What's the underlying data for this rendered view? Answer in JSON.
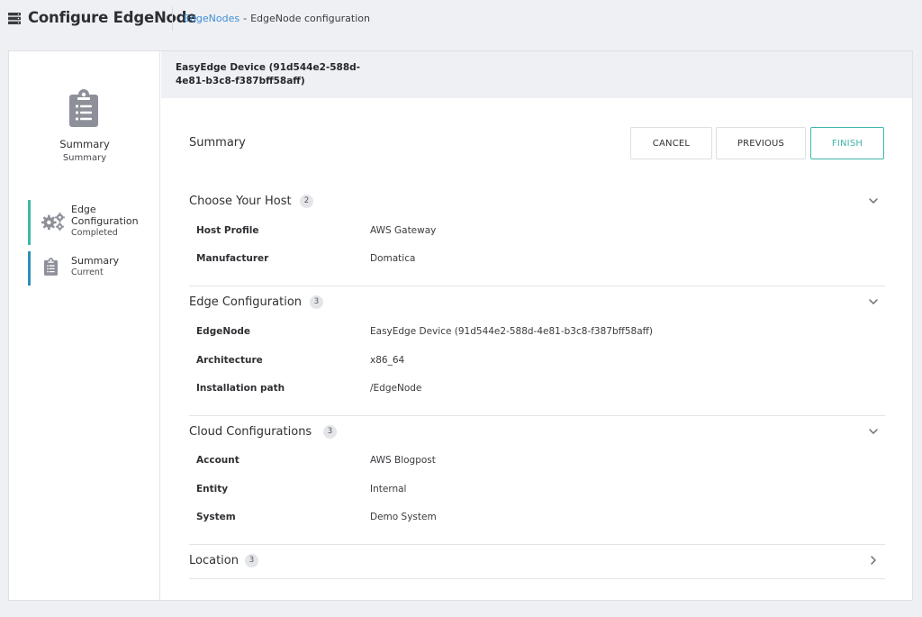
{
  "header": {
    "title": "Configure EdgeNode",
    "breadcrumb": {
      "link": "EdgeNodes",
      "separator": "-",
      "current": "EdgeNode configuration"
    },
    "app_icon": "server-icon"
  },
  "sidebar": {
    "head_icon": "clipboard-list-icon",
    "title": "Summary",
    "subtitle": "Summary",
    "steps": [
      {
        "name_line1": "Edge",
        "name_line2": "Configuration",
        "status": "Completed",
        "icon": "gears-icon",
        "accent": "#3fb8a8"
      },
      {
        "name_line1": "Summary",
        "status": "Current",
        "icon": "clipboard-list-icon",
        "accent": "#2f8fb8"
      }
    ]
  },
  "device": {
    "title": "EasyEdge Device (91d544e2-588d-4e81-b3c8-f387bff58aff)"
  },
  "main": {
    "title": "Summary",
    "buttons": {
      "cancel": "CANCEL",
      "previous": "PREVIOUS",
      "finish": "FINISH"
    },
    "finish_color": "#43b3aa"
  },
  "sections": [
    {
      "title": "Choose Your Host",
      "count": "2",
      "expanded": true,
      "rows": [
        {
          "label": "Host Profile",
          "value": "AWS Gateway"
        },
        {
          "label": "Manufacturer",
          "value": "Domatica"
        }
      ]
    },
    {
      "title": "Edge Configuration",
      "count": "3",
      "expanded": true,
      "rows": [
        {
          "label": "EdgeNode",
          "value": "EasyEdge Device (91d544e2-588d-4e81-b3c8-f387bff58aff)"
        },
        {
          "label": "Architecture",
          "value": "x86_64"
        },
        {
          "label": "Installation path",
          "value": "/EdgeNode"
        }
      ]
    },
    {
      "title": "Cloud Configurations",
      "count": "3",
      "expanded": true,
      "rows": [
        {
          "label": "Account",
          "value": "AWS Blogpost"
        },
        {
          "label": "Entity",
          "value": "Internal"
        },
        {
          "label": "System",
          "value": "Demo System"
        }
      ]
    },
    {
      "title": "Location",
      "count": "3",
      "expanded": false,
      "rows": []
    }
  ]
}
